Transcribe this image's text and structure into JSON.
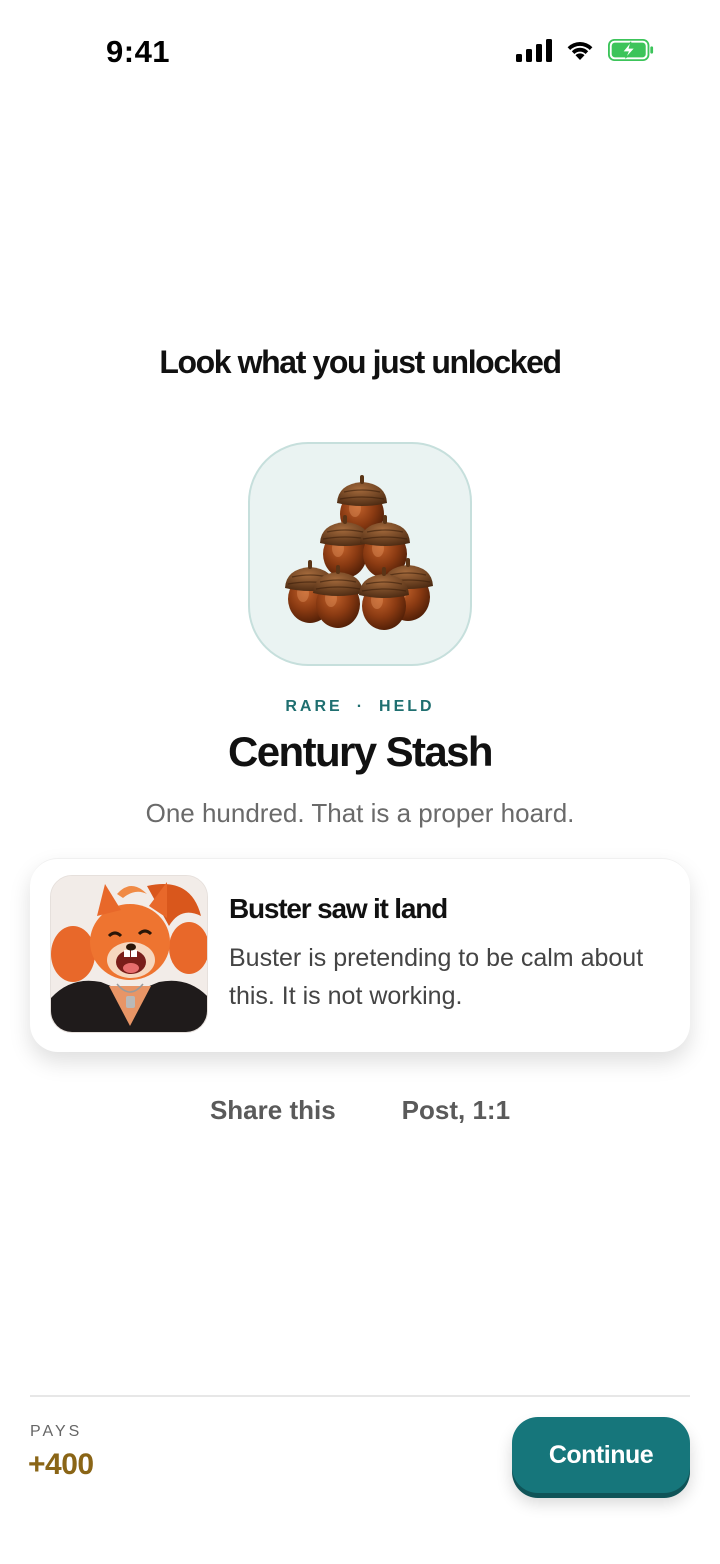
{
  "status_bar": {
    "time": "9:41",
    "icons": [
      "cellular-signal-icon",
      "wifi-icon",
      "battery-charging-icon"
    ]
  },
  "headline": "Look what you just unlocked",
  "achievement": {
    "icon": "acorn-pile-icon",
    "rarity": "RARE",
    "separator": "·",
    "state": "HELD",
    "title": "Century Stash",
    "description": "One hundred. That is a proper hoard."
  },
  "reaction_card": {
    "avatar": "buster-squirrel-avatar",
    "title": "Buster saw it land",
    "body": "Buster is pretending to be calm about this. It is not working."
  },
  "share": {
    "share_label": "Share this",
    "post_label": "Post, 1:1"
  },
  "footer": {
    "pays_label": "PAYS",
    "pays_value": "+400",
    "continue_label": "Continue"
  },
  "colors": {
    "accent_teal": "#16767b",
    "reward_gold": "#8a6516",
    "badge_bg": "#eaf3f2",
    "battery_green": "#3cc45a"
  }
}
